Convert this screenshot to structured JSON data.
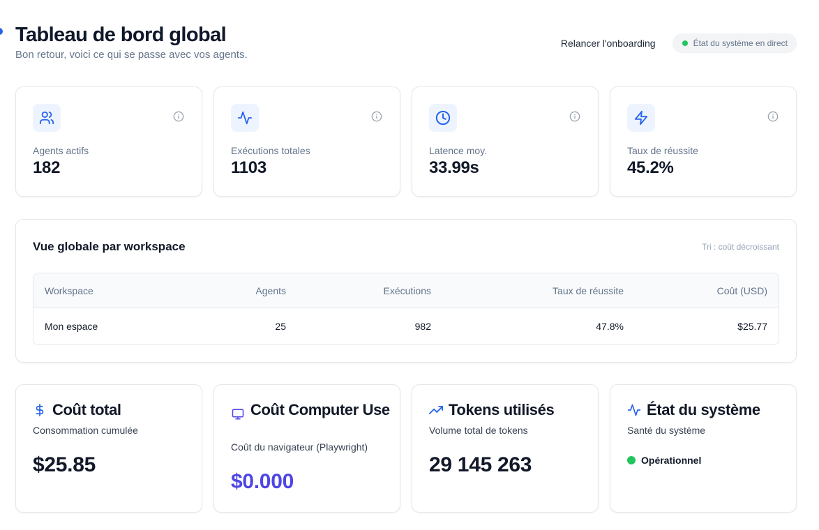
{
  "header": {
    "title": "Tableau de bord global",
    "subtitle": "Bon retour, voici ce qui se passe avec vos agents.",
    "onboarding_label": "Relancer l'onboarding",
    "status_label": "État du système en direct"
  },
  "stats": [
    {
      "icon": "users-icon",
      "label": "Agents actifs",
      "value": "182"
    },
    {
      "icon": "activity-icon",
      "label": "Exécutions totales",
      "value": "1103"
    },
    {
      "icon": "clock-icon",
      "label": "Latence moy.",
      "value": "33.99s"
    },
    {
      "icon": "zap-icon",
      "label": "Taux de réussite",
      "value": "45.2%"
    }
  ],
  "workspace_table": {
    "title": "Vue globale par workspace",
    "sort_label": "Tri : coût décroissant",
    "columns": [
      "Workspace",
      "Agents",
      "Exécutions",
      "Taux de réussite",
      "Coût (USD)"
    ],
    "rows": [
      [
        "Mon espace",
        "25",
        "982",
        "47.8%",
        "$25.77"
      ]
    ]
  },
  "cost_total": {
    "icon": "dollar-icon",
    "title": "Coût total",
    "subtitle": "Consommation cumulée",
    "value": "$25.85"
  },
  "cost_computer_use": {
    "icon": "monitor-icon",
    "title": "Coût Computer Use",
    "subtitle": "Coût du navigateur (Playwright)",
    "value": "$0.000"
  },
  "tokens": {
    "icon": "trending-up-icon",
    "title": "Tokens utilisés",
    "subtitle": "Volume total de tokens",
    "value": "29 145 263"
  },
  "system_state": {
    "icon": "activity-icon",
    "title": "État du système",
    "subtitle": "Santé du système",
    "status": "Opérationnel"
  },
  "colors": {
    "accent_blue": "#2563eb",
    "accent_purple": "#4f46e5",
    "status_green": "#22c55e"
  }
}
